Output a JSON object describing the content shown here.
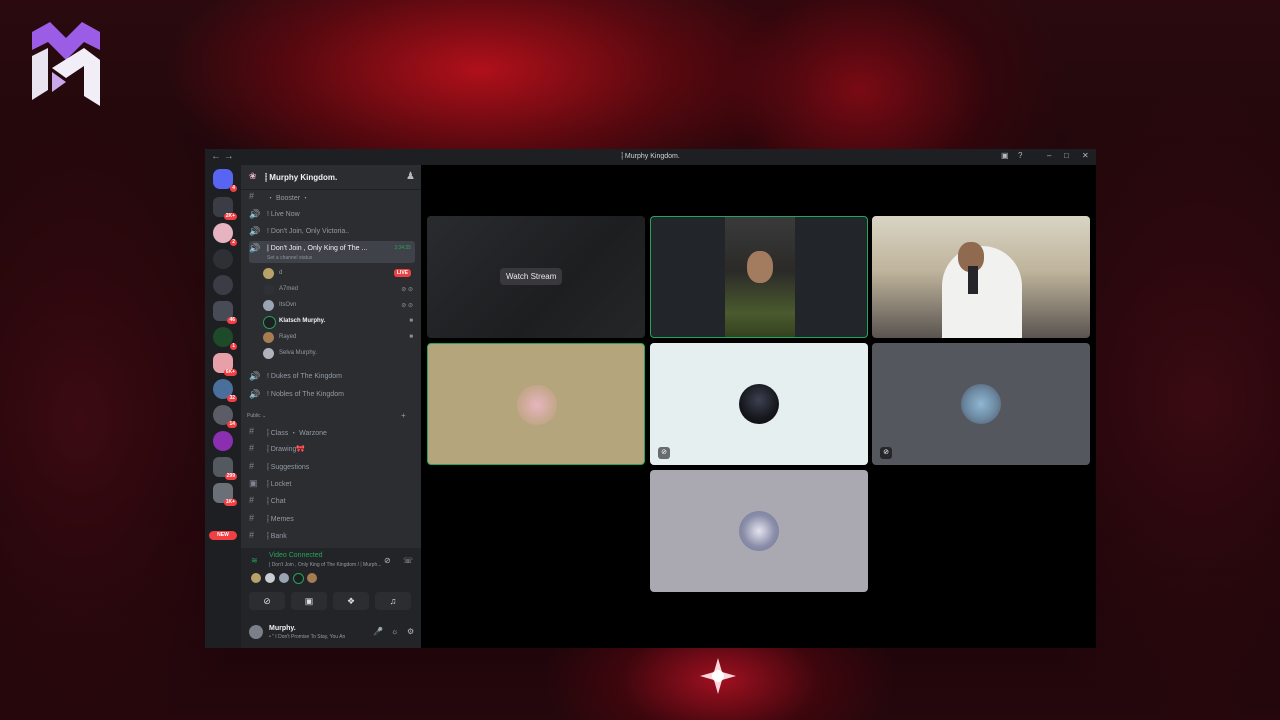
{
  "window": {
    "title": "⸽ Murphy Kingdom."
  },
  "server": {
    "name": "⸽ Murphy Kingdom."
  },
  "channels": [
    {
      "label": "・ Booster ・",
      "type": "text"
    },
    {
      "label": "! Live Now",
      "type": "voice"
    },
    {
      "label": "! Don't Join, Only Victoria..",
      "type": "voice"
    },
    {
      "label": "| Don't Join , Only King of The ...",
      "type": "voice",
      "active": true,
      "timer": "3:34:35",
      "status": "Set a channel status"
    }
  ],
  "voice_users": [
    {
      "name": "d",
      "live": "LIVE"
    },
    {
      "name": "A7med",
      "status": "muted deafened"
    },
    {
      "name": "ItsOvn",
      "status": "muted deafened"
    },
    {
      "name": "Klatsch Murphy.",
      "status": "video"
    },
    {
      "name": "Rayed",
      "status": "video"
    },
    {
      "name": "Selva Murphy.",
      "status": ""
    }
  ],
  "more_channels": [
    {
      "label": "! Dukes of The Kingdom"
    },
    {
      "label": "! Nobles of The Kingdom"
    }
  ],
  "category": {
    "label": "Public"
  },
  "public_channels": [
    {
      "label": "⸽ Class ・ Warzone",
      "icon": "#"
    },
    {
      "label": "⸽ Drawing🎀",
      "icon": "#"
    },
    {
      "label": "⸽ Suggestions",
      "icon": "#"
    },
    {
      "label": "⸽ Locket",
      "icon": "lock"
    },
    {
      "label": "⸽ Chat",
      "icon": "#"
    },
    {
      "label": "⸽ Memes",
      "icon": "#"
    },
    {
      "label": "⸽ Bank",
      "icon": "#"
    }
  ],
  "rail_badges": [
    "4",
    "2K+",
    "2",
    "46",
    "1",
    "6K+",
    "32",
    "14",
    "299",
    "1K+"
  ],
  "new_badge": "NEW",
  "voice_panel": {
    "title": "Video Connected",
    "location": "| Don't Join , Only King of The Kingdom / ⸽ Murph..."
  },
  "user": {
    "name": "Murphy.",
    "status": "• \" I Don't Promise To Stay, You An"
  },
  "stage": {
    "watch_label": "Watch Stream"
  },
  "colors": {
    "accent_green": "#23a55a",
    "live_red": "#ed4245",
    "bg": "#000000"
  }
}
